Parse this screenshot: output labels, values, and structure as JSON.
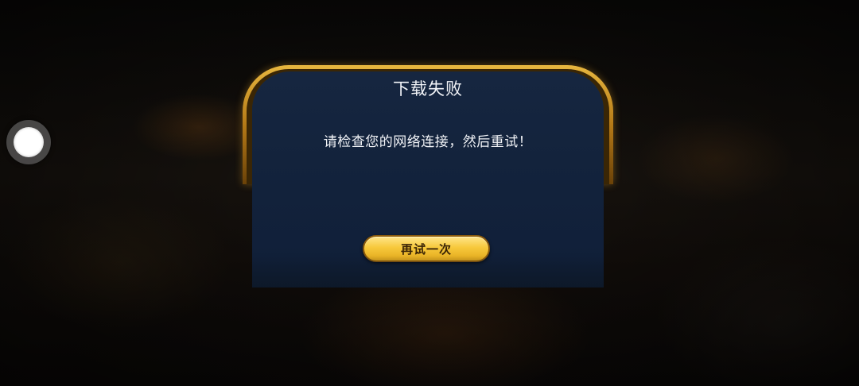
{
  "dialog": {
    "title": "下载失败",
    "message": "请检查您的网络连接，然后重试！",
    "retry_label": "再试一次"
  },
  "colors": {
    "dialog_bg": "#12223b",
    "frame_gold": "#e7b63f",
    "button_gold": "#f7c93c"
  },
  "icons": {
    "floating_button": "assistive-touch-icon"
  }
}
